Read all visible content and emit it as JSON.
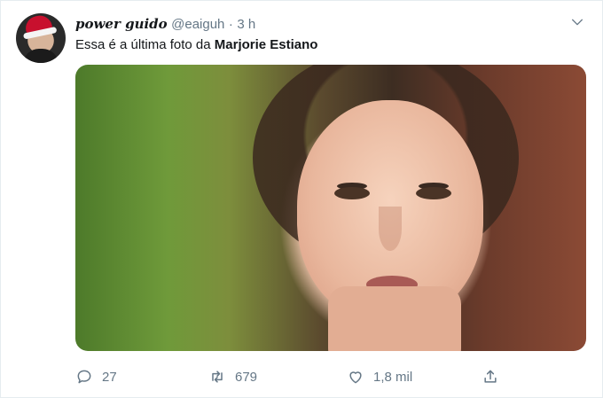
{
  "tweet": {
    "author_name": "power guido",
    "handle": "@eaiguh",
    "separator": "·",
    "time": "3 h",
    "text_prefix": "Essa é a última foto da ",
    "text_bold": "Marjorie Estiano"
  },
  "actions": {
    "reply_count": "27",
    "retweet_count": "679",
    "like_count": "1,8 mil"
  },
  "icons": {
    "reply": "comment-icon",
    "retweet": "retweet-icon",
    "like": "heart-icon",
    "share": "share-icon",
    "menu": "chevron-down-icon"
  },
  "colors": {
    "meta": "#657786",
    "text": "#14171a"
  }
}
